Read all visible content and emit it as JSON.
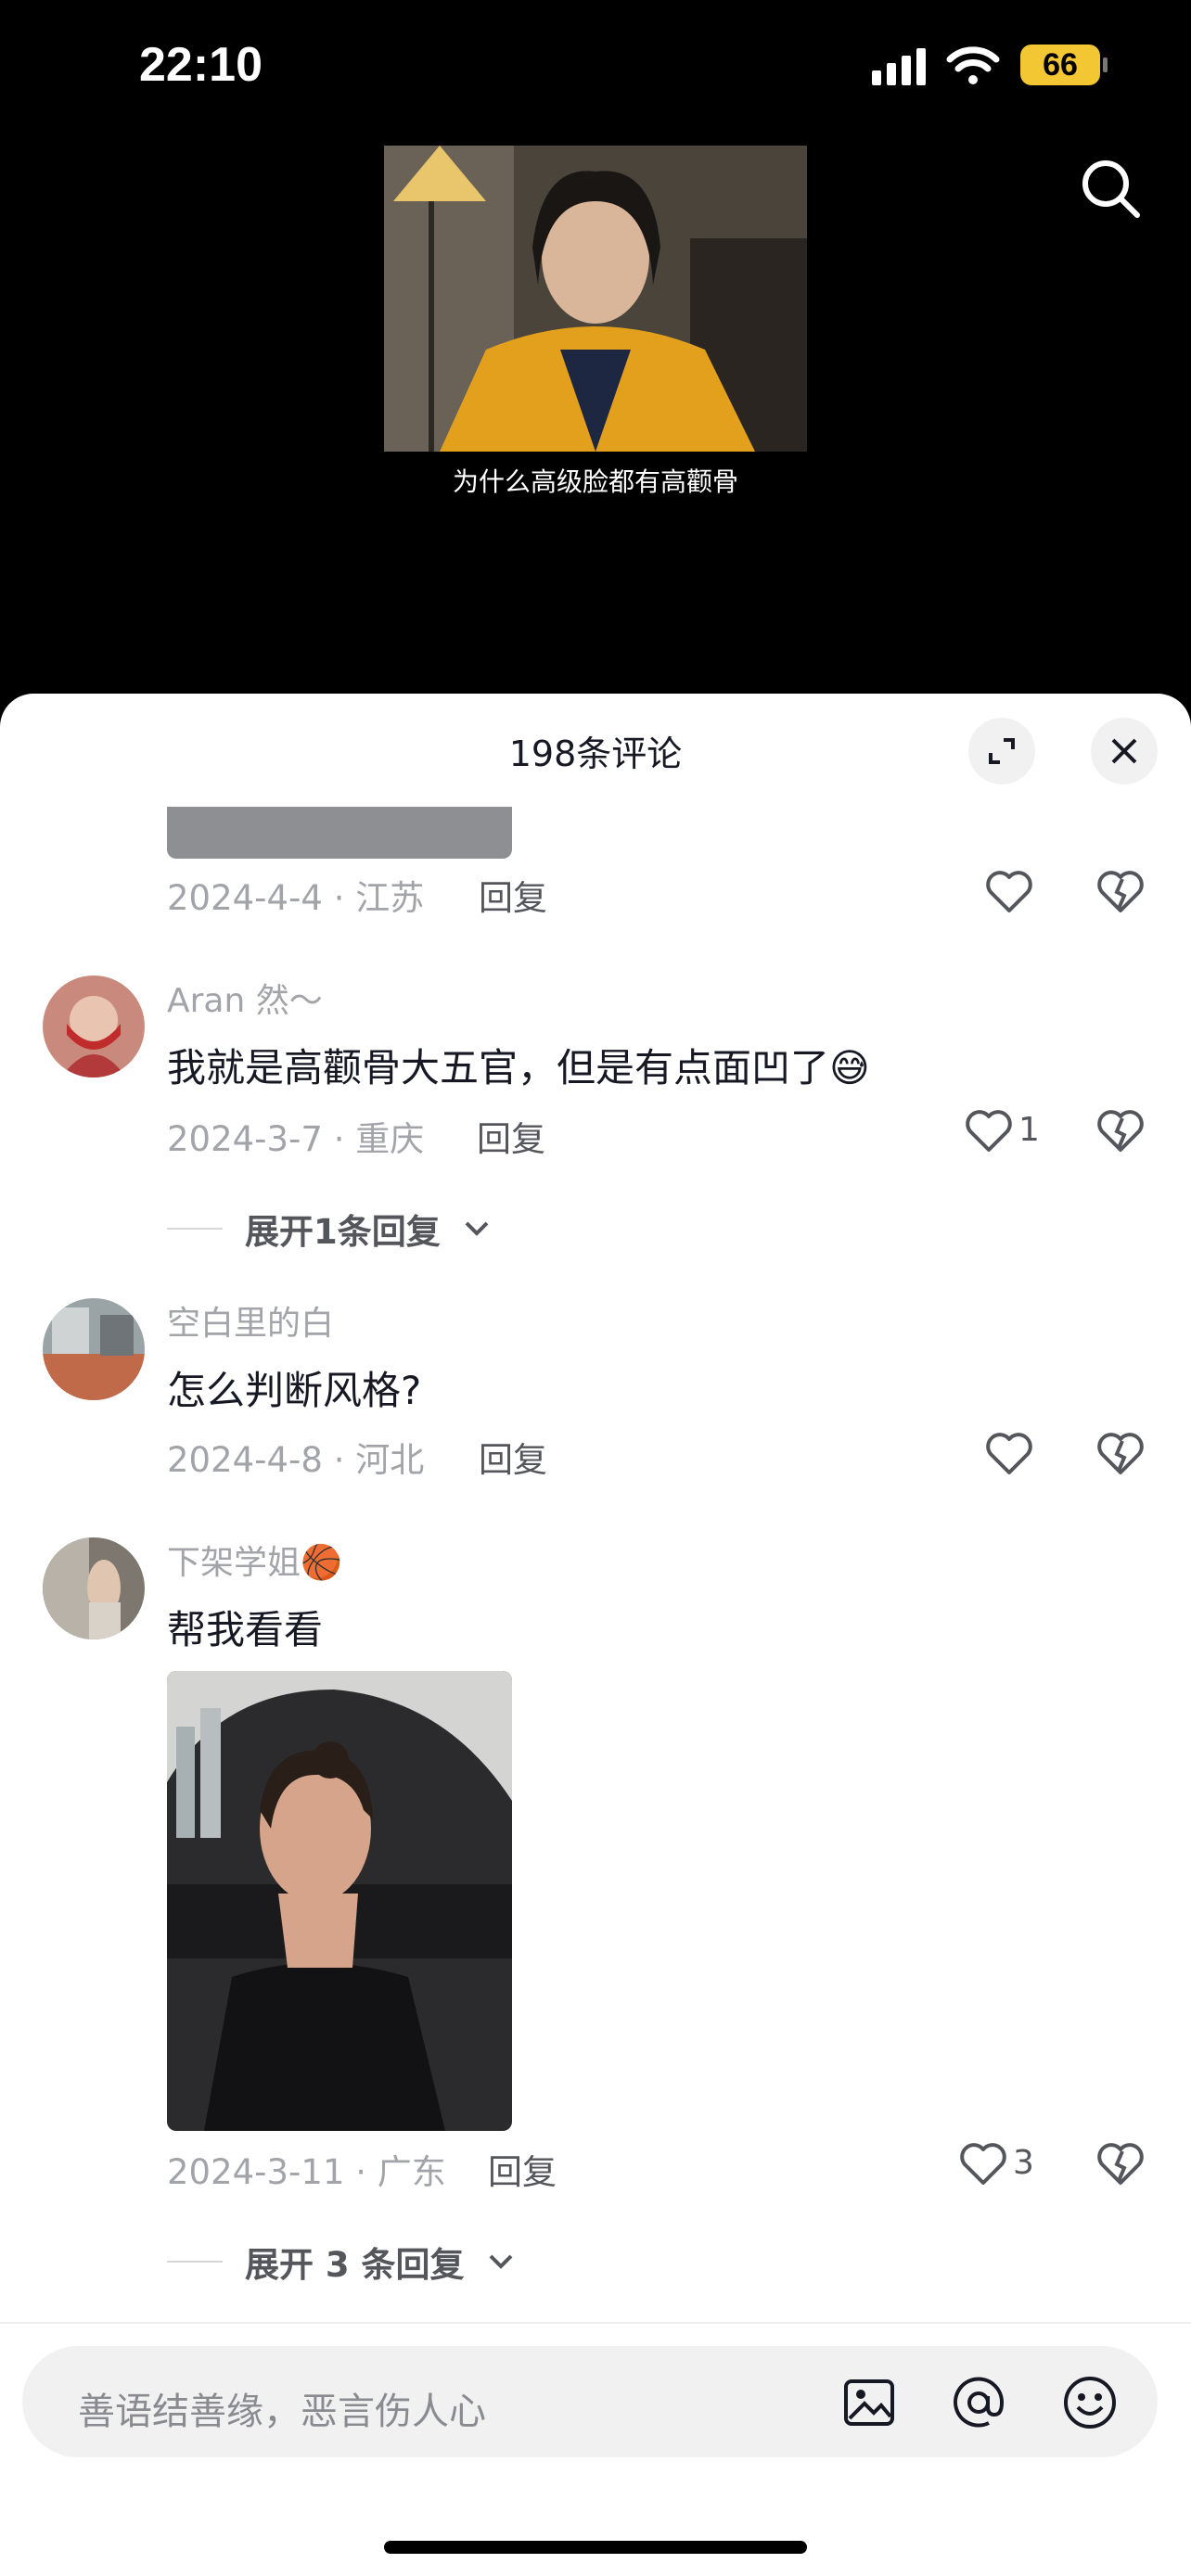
{
  "status": {
    "time": "22:10",
    "battery": "66"
  },
  "video": {
    "caption": "为什么高级脸都有高颧骨"
  },
  "sheet": {
    "title": "198条评论"
  },
  "comments": [
    {
      "date_location": "2024-4-4 · 江苏",
      "reply": "回复"
    },
    {
      "username": "Aran 然～",
      "text": "我就是高颧骨大五官，但是有点面凹了",
      "emoji": "😅",
      "date_location": "2024-3-7 · 重庆",
      "reply": "回复",
      "likes": "1",
      "expand": "展开1条回复"
    },
    {
      "username": "空白里的白",
      "text": "怎么判断风格?",
      "date_location": "2024-4-8 · 河北",
      "reply": "回复"
    },
    {
      "username": "下架学姐",
      "username_emoji": "🏀",
      "text": "帮我看看",
      "date_location": "2024-3-11 · 广东",
      "reply": "回复",
      "likes": "3",
      "expand": "展开 3 条回复"
    }
  ],
  "input": {
    "placeholder": "善语结善缘，恶言伤人心"
  },
  "colors": {
    "accent_battery": "#f3c634",
    "text": "#161823",
    "meta": "#a3a4a9"
  }
}
